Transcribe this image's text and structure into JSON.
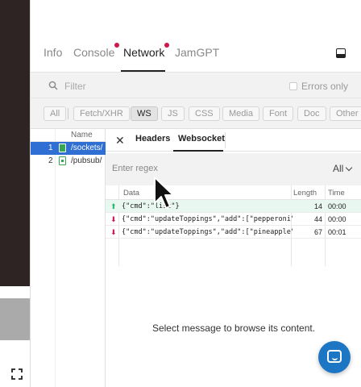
{
  "tabs": [
    {
      "label": "Info",
      "active": false,
      "dot": false
    },
    {
      "label": "Console",
      "active": false,
      "dot": true
    },
    {
      "label": "Network",
      "active": true,
      "dot": true
    },
    {
      "label": "JamGPT",
      "active": false,
      "dot": false
    }
  ],
  "filter": {
    "placeholder": "Filter",
    "errors_only_label": "Errors only"
  },
  "types": [
    "All",
    "Fetch/XHR",
    "WS",
    "JS",
    "CSS",
    "Media",
    "Font",
    "Doc",
    "Other"
  ],
  "active_type": "WS",
  "requests": {
    "name_header": "Name",
    "rows": [
      {
        "num": "1",
        "name": "/sockets/",
        "selected": true
      },
      {
        "num": "2",
        "name": "/pubsub/",
        "selected": false
      }
    ]
  },
  "detail": {
    "tabs": [
      "Headers",
      "Websocket"
    ],
    "active_tab": "Websocket",
    "regex_placeholder": "Enter regex",
    "direction": "All",
    "columns": {
      "data": "Data",
      "length": "Length",
      "time": "Time"
    },
    "messages": [
      {
        "direction": "sent",
        "data": "{\"cmd\":\"list\"}",
        "length": "14",
        "time": "00:00"
      },
      {
        "direction": "received",
        "data": "{\"cmd\":\"updateToppings\",\"add\":[\"pepperoni\"",
        "length": "44",
        "time": "00:00"
      },
      {
        "direction": "received",
        "data": "{\"cmd\":\"updateToppings\",\"add\":[\"pineapple\"",
        "length": "67",
        "time": "00:01"
      }
    ],
    "empty_text": "Select message to browse its content."
  },
  "colors": {
    "accent": "#2f6fd3",
    "tab_dot": "#d0174a",
    "sent_arrow": "#2bb673",
    "received_arrow": "#d0174a",
    "chat_button": "#1c76c4"
  },
  "icons": {
    "search": "search-icon",
    "dock": "dock-bottom-icon",
    "close": "close-icon",
    "chat": "chat-icon",
    "expand": "expand-icon",
    "file": "websocket-file-icon"
  }
}
